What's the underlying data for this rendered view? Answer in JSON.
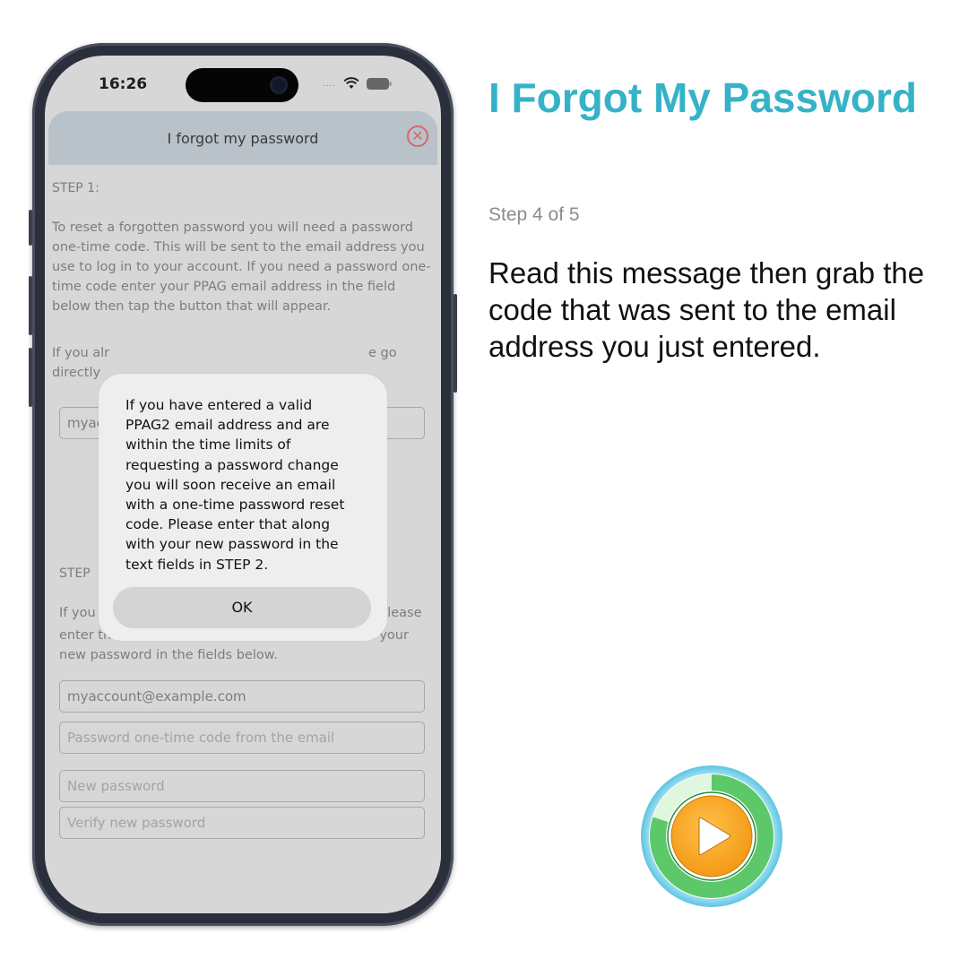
{
  "phone": {
    "status_time": "16:26",
    "sheet_title": "I forgot my password",
    "step1": {
      "label": "STEP 1:",
      "paragraph": "To reset a forgotten password you will need a password one-time code.  This will be sent to the email address you use to log in to your account.  If you need a password one-time code enter your PPAG email address in the field below then tap the button that will appear.",
      "partial_left": "If you alr",
      "partial_right": "e go",
      "partial_left2": "directly",
      "email_partial": "myac"
    },
    "step2": {
      "label": "STEP",
      "partial_left": "If you a",
      "partial_right": "please",
      "paragraph_rest": "enter the account email, the one-time code, and your new password in the fields below.",
      "email_value": "myaccount@example.com",
      "code_placeholder": "Password one-time code from the email",
      "new_password_placeholder": "New password",
      "verify_password_placeholder": "Verify new password"
    },
    "alert": {
      "message": "If you have entered a valid PPAG2 email address and are within the time limits of requesting a password change you will soon receive an email with a one-time password reset code.  Please enter that along with your new password in the text fields in STEP 2.",
      "ok_label": "OK"
    },
    "icons": {
      "close": "close-circle-icon",
      "wifi": "wifi-icon",
      "battery": "battery-icon"
    }
  },
  "page": {
    "title": "I Forgot My Password",
    "step_indicator": "Step 4 of 5",
    "instruction": "Read this message then grab the code that was sent to the email address you just entered.",
    "progress_fraction": 0.8
  },
  "colors": {
    "title": "#36b2c8",
    "play_orange": "#f7a41c",
    "progress_green": "#5cc86a",
    "ring_blue": "#7fd3ea"
  }
}
